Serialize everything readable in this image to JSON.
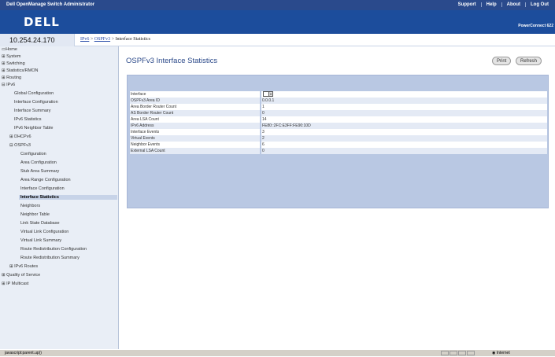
{
  "topbar": {
    "title": "Dell OpenManage Switch Administrator",
    "links": [
      "Support",
      "Help",
      "About",
      "Log Out"
    ]
  },
  "brand": {
    "logo": "DELL",
    "model": "PowerConnect 622"
  },
  "address": {
    "ip": "10.254.24.170"
  },
  "breadcrumb": {
    "part1": "IPv6",
    "sep1": " > ",
    "part2": "OSPFv3",
    "sep2": " > ",
    "current": "Interface Statistics"
  },
  "sidebar": {
    "items": [
      {
        "label": "Home"
      },
      {
        "label": "System"
      },
      {
        "label": "Switching"
      },
      {
        "label": "Statistics/RMON"
      },
      {
        "label": "Routing"
      },
      {
        "label": "IPv6"
      },
      {
        "label": "Global Configuration"
      },
      {
        "label": "Interface Configuration"
      },
      {
        "label": "Interface Summary"
      },
      {
        "label": "IPv6 Statistics"
      },
      {
        "label": "IPv6 Neighbor Table"
      },
      {
        "label": "DHCPv6"
      },
      {
        "label": "OSPFv3"
      },
      {
        "label": "Configuration"
      },
      {
        "label": "Area Configuration"
      },
      {
        "label": "Stub Area Summary"
      },
      {
        "label": "Area Range Configuration"
      },
      {
        "label": "Interface Configuration"
      },
      {
        "label": "Interface Statistics"
      },
      {
        "label": "Neighbors"
      },
      {
        "label": "Neighbor Table"
      },
      {
        "label": "Link State Database"
      },
      {
        "label": "Virtual Link Configuration"
      },
      {
        "label": "Virtual Link Summary"
      },
      {
        "label": "Route Redistribution Configuration"
      },
      {
        "label": "Route Redistribution Summary"
      },
      {
        "label": "IPv6 Routes"
      },
      {
        "label": "Quality of Service"
      },
      {
        "label": "IP Multicast"
      }
    ]
  },
  "main": {
    "title": "OSPFv3 Interface Statistics",
    "print_label": "Print",
    "refresh_label": "Refresh",
    "rows": [
      {
        "label": "Interface",
        "value": ""
      },
      {
        "label": "OSPFv3 Area ID",
        "value": "0.0.0.1"
      },
      {
        "label": "Area Border Router Count",
        "value": "1"
      },
      {
        "label": "AS Border Router Count",
        "value": "0"
      },
      {
        "label": "Area LSA Count",
        "value": "14"
      },
      {
        "label": "IPv6 Address",
        "value": "FE80::2FC:E3FF:FE90:10D"
      },
      {
        "label": "Interface Events",
        "value": "3"
      },
      {
        "label": "Virtual Events",
        "value": "2"
      },
      {
        "label": "Neighbor Events",
        "value": "6"
      },
      {
        "label": "External LSA Count",
        "value": "0"
      }
    ]
  },
  "status": {
    "message": "javascript:parent.up()",
    "zone": "Internet"
  }
}
